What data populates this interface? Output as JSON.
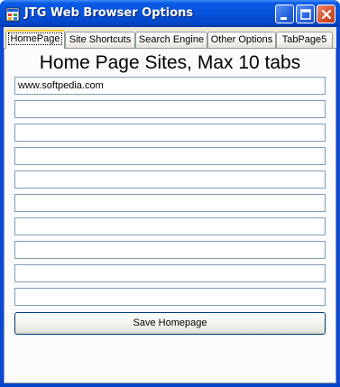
{
  "window": {
    "title": "JTG Web Browser Options",
    "controls": {
      "minimize": "minimize-icon",
      "maximize": "maximize-icon",
      "close": "close-icon"
    }
  },
  "tabs": [
    {
      "label": "HomePage",
      "active": true
    },
    {
      "label": "Site Shortcuts",
      "active": false
    },
    {
      "label": "Search Engine",
      "active": false
    },
    {
      "label": "Other Options",
      "active": false
    },
    {
      "label": "TabPage5",
      "active": false
    }
  ],
  "homepage": {
    "heading": "Home Page Sites, Max 10 tabs",
    "fields": [
      "www.softpedia.com",
      "",
      "",
      "",
      "",
      "",
      "",
      "",
      "",
      ""
    ],
    "save_label": "Save Homepage"
  },
  "colors": {
    "titlebar": "#0552db",
    "face": "#ece9d8",
    "active_tab_accent": "#ffc73c",
    "field_border": "#7f9db9",
    "button_border": "#003c74"
  }
}
